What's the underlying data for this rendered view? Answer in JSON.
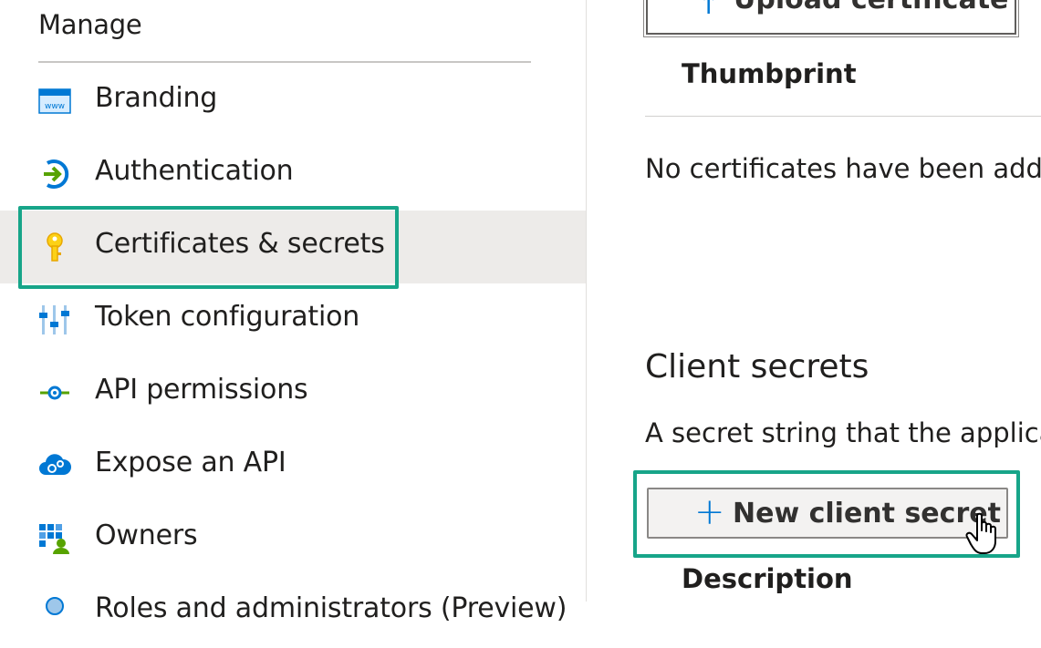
{
  "sidebar": {
    "section_title": "Manage",
    "items": [
      {
        "label": "Branding",
        "icon": "branding-icon"
      },
      {
        "label": "Authentication",
        "icon": "authentication-icon"
      },
      {
        "label": "Certificates & secrets",
        "icon": "key-icon",
        "selected": true
      },
      {
        "label": "Token configuration",
        "icon": "token-configuration-icon"
      },
      {
        "label": "API permissions",
        "icon": "api-permissions-icon"
      },
      {
        "label": "Expose an API",
        "icon": "cloud-gear-icon"
      },
      {
        "label": "Owners",
        "icon": "owners-icon"
      },
      {
        "label": "Roles and administrators (Preview)",
        "icon": "roles-icon"
      }
    ]
  },
  "main": {
    "certificates": {
      "upload_button_label": "Upload certificate",
      "upload_icon": "upload-arrow-icon",
      "column_thumbprint": "Thumbprint",
      "empty_message": "No certificates have been added"
    },
    "client_secrets": {
      "title": "Client secrets",
      "description": "A secret string that the application uses",
      "new_button_label": "New client secret",
      "new_button_icon": "plus-icon",
      "column_description": "Description"
    }
  },
  "colors": {
    "highlight": "#17a589",
    "accent": "#0078d4",
    "selected_bg": "#edebe9"
  }
}
